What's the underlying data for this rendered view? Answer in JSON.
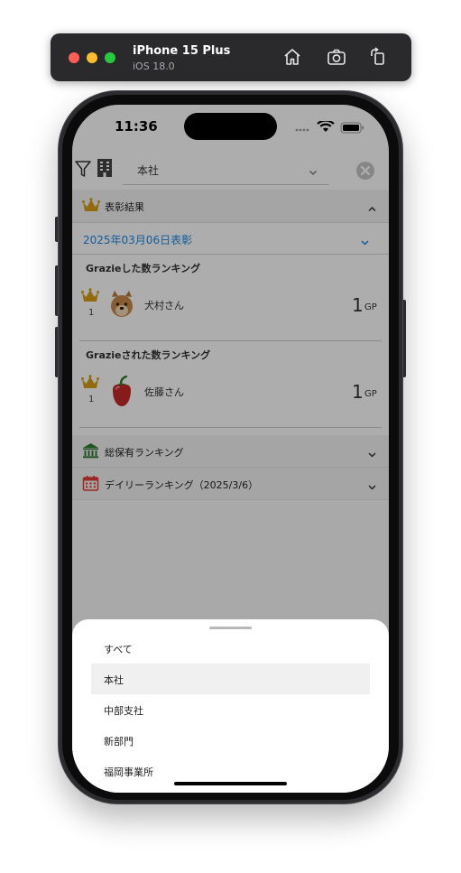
{
  "simulator": {
    "device_name": "iPhone 15 Plus",
    "os_version": "iOS 18.0",
    "toolbar_icons": [
      "home-icon",
      "screenshot-camera-icon",
      "rotate-icon"
    ]
  },
  "status_bar": {
    "time": "11:36",
    "icons": [
      "cellular-signal-icon",
      "wifi-icon",
      "battery-icon"
    ]
  },
  "filter_bar": {
    "branch_value": "本社",
    "icons": [
      "filter-icon",
      "building-icon",
      "clear-icon"
    ]
  },
  "award_section": {
    "title": "表彰結果",
    "date_label": "2025年03月06日表彰",
    "given_ranking": {
      "heading": "Grazieした数ランキング",
      "entries": [
        {
          "rank": "1",
          "name": "犬村さん",
          "points": "1",
          "unit": "GP",
          "avatar": "dog-avatar"
        }
      ]
    },
    "received_ranking": {
      "heading": "Grazieされた数ランキング",
      "entries": [
        {
          "rank": "1",
          "name": "佐藤さん",
          "points": "1",
          "unit": "GP",
          "avatar": "pepper-avatar"
        }
      ]
    }
  },
  "collapsed_sections": [
    {
      "title": "総保有ランキング",
      "icon": "bank-icon"
    },
    {
      "title": "デイリーランキング（2025/3/6）",
      "icon": "calendar-icon"
    }
  ],
  "branch_picker": {
    "selected": "本社",
    "options": [
      "すべて",
      "本社",
      "中部支社",
      "新部門",
      "福岡事業所"
    ]
  },
  "colors": {
    "accent_blue": "#1e88e5",
    "crown_gold": "#d4a017",
    "bank_green": "#2e7d32",
    "calendar_red": "#e53935",
    "selected_row": "#f0f0f0"
  }
}
